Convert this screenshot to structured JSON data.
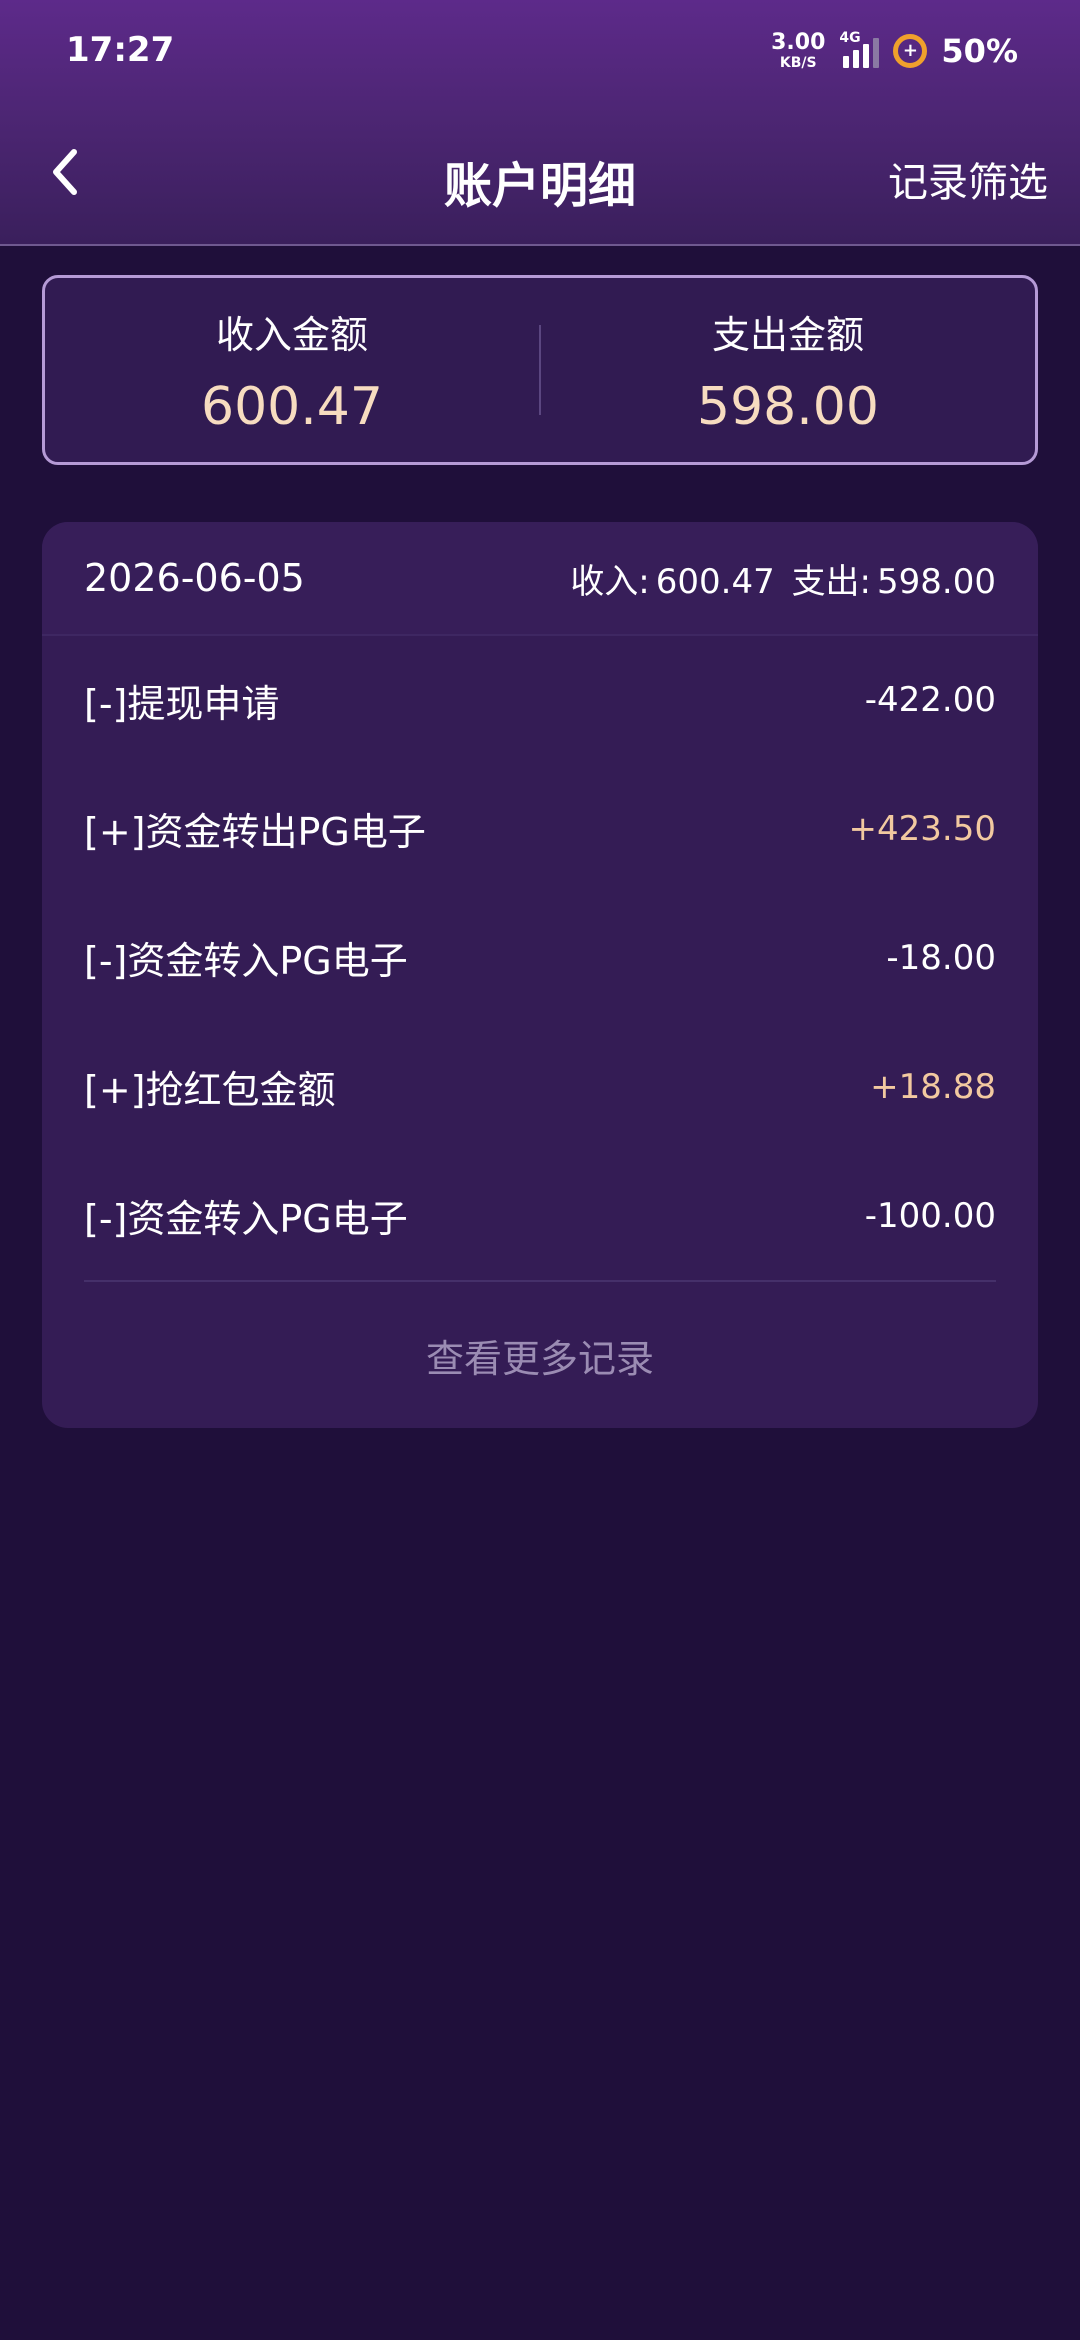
{
  "status_bar": {
    "time": "17:27",
    "net_speed_value": "3.00",
    "net_speed_unit": "KB/S",
    "network_type": "4G",
    "battery_percent": "50%",
    "battery_ring_color": "#f0a02c"
  },
  "nav": {
    "back_icon": "chevron-left-icon",
    "title": "账户明细",
    "filter_label": "记录筛选"
  },
  "summary": {
    "income_label": "收入金额",
    "income_value": "600.47",
    "expense_label": "支出金额",
    "expense_value": "598.00"
  },
  "records": {
    "date": "2026-06-05",
    "income_label": "收入:",
    "income_value": "600.47",
    "expense_label": "支出:",
    "expense_value": "598.00",
    "items": [
      {
        "name": "[-]提现申请",
        "amount": "-422.00"
      },
      {
        "name": "[+]资金转出PG电子",
        "amount": "+423.50"
      },
      {
        "name": "[-]资金转入PG电子",
        "amount": "-18.00"
      },
      {
        "name": "[+]抢红包金额",
        "amount": "+18.88"
      },
      {
        "name": "[-]资金转入PG电子",
        "amount": "-100.00"
      }
    ],
    "more_label": "查看更多记录"
  },
  "colors": {
    "background": "#1f0f3a",
    "accent_amount": "#f7dcc0",
    "positive_amount": "#f2c9a0"
  }
}
